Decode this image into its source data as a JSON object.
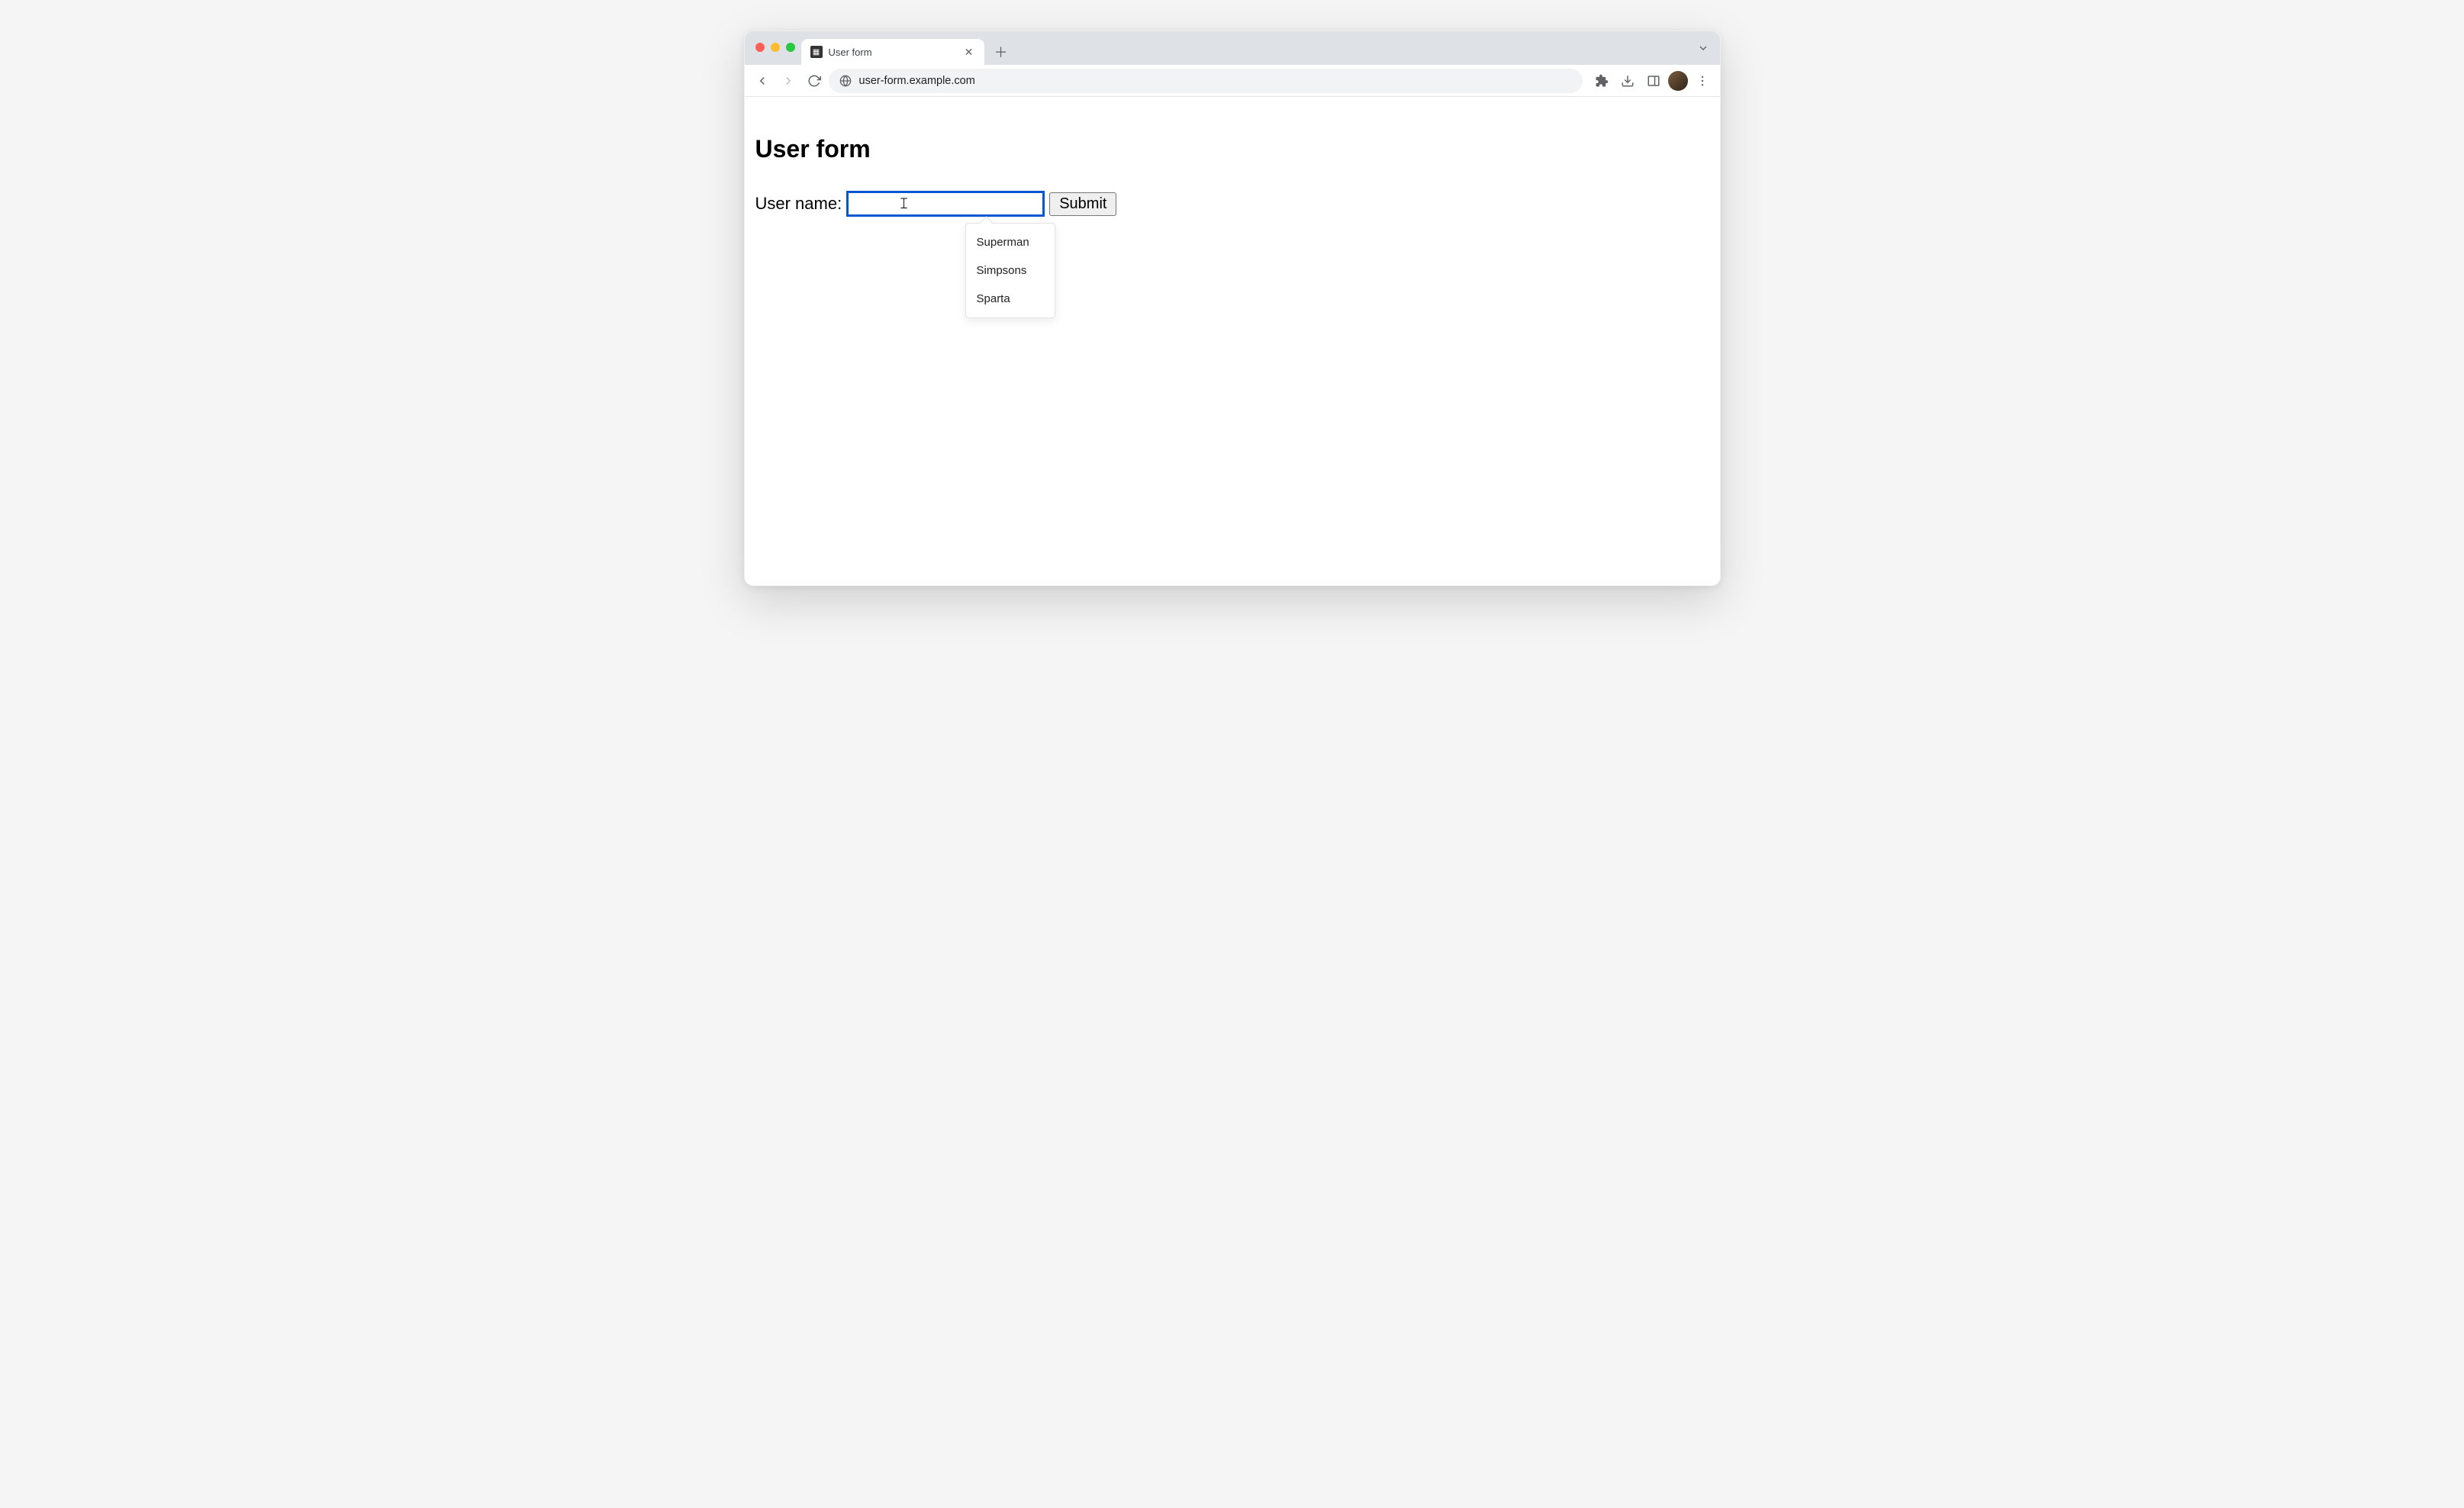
{
  "browser": {
    "tab_title": "User form",
    "url": "user-form.example.com"
  },
  "page": {
    "heading": "User form",
    "form": {
      "label": "User name:",
      "input_value": "",
      "submit_label": "Submit"
    },
    "autocomplete": {
      "options": [
        "Superman",
        "Simpsons",
        "Sparta"
      ]
    }
  }
}
